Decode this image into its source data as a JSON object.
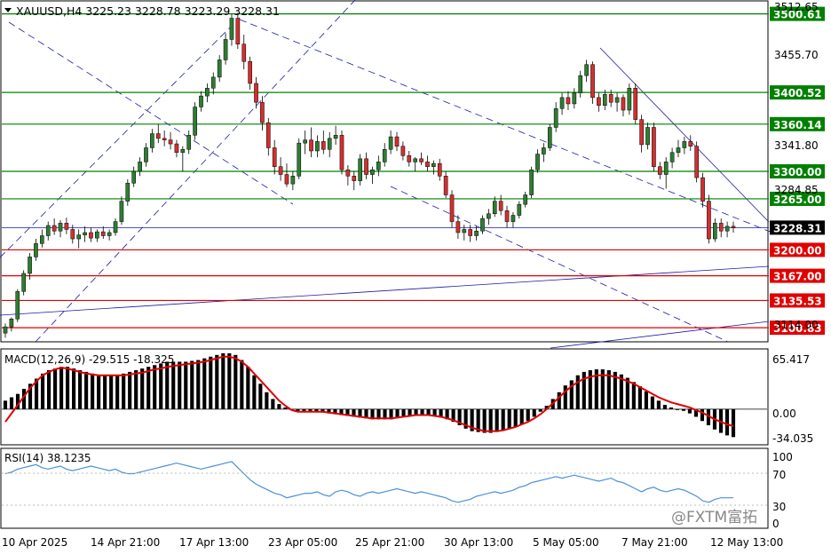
{
  "header": {
    "symbol_line": "XAUUSD,H4  3225.23 3228.78 3223.29 3228.31",
    "dropdown_icon": "triangle-down-icon"
  },
  "colors": {
    "bull": "#2e7d32",
    "bear": "#d32f2f",
    "support": "#e00000",
    "resistance": "#008000",
    "trend": "#1a1aa8",
    "macd_hist": "#000000",
    "macd_signal": "#e00000",
    "rsi_line": "#4a90d9",
    "grid_text": "#000000"
  },
  "price_axis": {
    "top_label_partial": "3512.65",
    "tick_labels": [
      "3455.70",
      "3341.80",
      "3284.85",
      "3114.00"
    ]
  },
  "levels": [
    {
      "name": "resistance-3500",
      "value": 3500.61,
      "label": "3500.61",
      "kind": "resistance"
    },
    {
      "name": "resistance-3400",
      "value": 3400.52,
      "label": "3400.52",
      "kind": "resistance"
    },
    {
      "name": "resistance-3360",
      "value": 3360.14,
      "label": "3360.14",
      "kind": "resistance"
    },
    {
      "name": "resistance-3300",
      "value": 3300.0,
      "label": "3300.00",
      "kind": "resistance"
    },
    {
      "name": "resistance-3265",
      "value": 3265.0,
      "label": "3265.00",
      "kind": "resistance"
    },
    {
      "name": "current-price",
      "value": 3228.31,
      "label": "3228.31",
      "kind": "current"
    },
    {
      "name": "support-3200",
      "value": 3200.0,
      "label": "3200.00",
      "kind": "support"
    },
    {
      "name": "support-3167",
      "value": 3167.0,
      "label": "3167.00",
      "kind": "support"
    },
    {
      "name": "support-3135",
      "value": 3135.53,
      "label": "3135.53",
      "kind": "support"
    },
    {
      "name": "support-3100",
      "value": 3100.83,
      "label": "3100.83",
      "kind": "support"
    }
  ],
  "macd": {
    "title": "MACD(12,26,9) -29.515 -18.325",
    "tick_labels": [
      "65.417",
      "0.00",
      "-34.035"
    ],
    "ylim": [
      -40,
      68
    ]
  },
  "rsi": {
    "title": "RSI(14) 38.1235",
    "tick_labels": [
      "100",
      "70",
      "30",
      "0"
    ],
    "ylim": [
      0,
      100
    ]
  },
  "time_axis": {
    "labels": [
      "10 Apr 2025",
      "14 Apr 21:00",
      "17 Apr 13:00",
      "23 Apr 05:00",
      "25 Apr 21:00",
      "30 Apr 13:00",
      "5 May 05:00",
      "7 May 21:00",
      "12 May 13:00"
    ]
  },
  "watermark": {
    "text": "@FXTM富拓"
  },
  "chart_data": {
    "type": "candlestick",
    "symbol": "XAUUSD",
    "timeframe": "H4",
    "ylim": [
      3084,
      3516
    ],
    "candles": [
      [
        3094,
        3106,
        3088,
        3102
      ],
      [
        3102,
        3114,
        3096,
        3112
      ],
      [
        3112,
        3150,
        3108,
        3147
      ],
      [
        3147,
        3174,
        3142,
        3170
      ],
      [
        3170,
        3196,
        3162,
        3191
      ],
      [
        3191,
        3214,
        3186,
        3208
      ],
      [
        3208,
        3226,
        3203,
        3218
      ],
      [
        3218,
        3236,
        3212,
        3231
      ],
      [
        3231,
        3240,
        3219,
        3224
      ],
      [
        3224,
        3238,
        3216,
        3234
      ],
      [
        3234,
        3241,
        3220,
        3226
      ],
      [
        3226,
        3232,
        3208,
        3214
      ],
      [
        3214,
        3226,
        3202,
        3219
      ],
      [
        3219,
        3230,
        3210,
        3222
      ],
      [
        3222,
        3228,
        3210,
        3215
      ],
      [
        3215,
        3226,
        3210,
        3223
      ],
      [
        3223,
        3230,
        3214,
        3218
      ],
      [
        3218,
        3226,
        3212,
        3222
      ],
      [
        3222,
        3240,
        3218,
        3236
      ],
      [
        3236,
        3268,
        3232,
        3262
      ],
      [
        3262,
        3290,
        3256,
        3285
      ],
      [
        3285,
        3306,
        3280,
        3300
      ],
      [
        3300,
        3318,
        3294,
        3312
      ],
      [
        3312,
        3336,
        3306,
        3330
      ],
      [
        3330,
        3354,
        3324,
        3348
      ],
      [
        3348,
        3360,
        3336,
        3342
      ],
      [
        3342,
        3352,
        3332,
        3340
      ],
      [
        3340,
        3350,
        3328,
        3335
      ],
      [
        3335,
        3340,
        3318,
        3324
      ],
      [
        3324,
        3332,
        3300,
        3328
      ],
      [
        3328,
        3352,
        3322,
        3346
      ],
      [
        3346,
        3388,
        3340,
        3382
      ],
      [
        3382,
        3402,
        3376,
        3396
      ],
      [
        3396,
        3412,
        3388,
        3406
      ],
      [
        3406,
        3426,
        3398,
        3420
      ],
      [
        3420,
        3448,
        3414,
        3442
      ],
      [
        3442,
        3476,
        3436,
        3468
      ],
      [
        3468,
        3500,
        3460,
        3495
      ],
      [
        3495,
        3502,
        3456,
        3462
      ],
      [
        3462,
        3474,
        3430,
        3440
      ],
      [
        3440,
        3446,
        3404,
        3412
      ],
      [
        3412,
        3420,
        3380,
        3388
      ],
      [
        3388,
        3396,
        3352,
        3362
      ],
      [
        3362,
        3368,
        3320,
        3330
      ],
      [
        3330,
        3340,
        3296,
        3306
      ],
      [
        3306,
        3318,
        3288,
        3296
      ],
      [
        3296,
        3310,
        3280,
        3284
      ],
      [
        3284,
        3300,
        3276,
        3294
      ],
      [
        3294,
        3342,
        3290,
        3336
      ],
      [
        3336,
        3352,
        3322,
        3340
      ],
      [
        3340,
        3356,
        3318,
        3326
      ],
      [
        3326,
        3346,
        3318,
        3338
      ],
      [
        3338,
        3352,
        3322,
        3328
      ],
      [
        3328,
        3350,
        3318,
        3342
      ],
      [
        3342,
        3358,
        3334,
        3346
      ],
      [
        3346,
        3352,
        3296,
        3302
      ],
      [
        3302,
        3308,
        3282,
        3294
      ],
      [
        3294,
        3300,
        3276,
        3288
      ],
      [
        3288,
        3322,
        3282,
        3316
      ],
      [
        3316,
        3324,
        3290,
        3296
      ],
      [
        3296,
        3306,
        3284,
        3302
      ],
      [
        3302,
        3320,
        3294,
        3312
      ],
      [
        3312,
        3336,
        3306,
        3328
      ],
      [
        3328,
        3352,
        3322,
        3344
      ],
      [
        3344,
        3350,
        3326,
        3332
      ],
      [
        3332,
        3338,
        3314,
        3320
      ],
      [
        3320,
        3326,
        3306,
        3312
      ],
      [
        3312,
        3318,
        3300,
        3316
      ],
      [
        3316,
        3324,
        3308,
        3312
      ],
      [
        3312,
        3320,
        3300,
        3306
      ],
      [
        3306,
        3314,
        3296,
        3310
      ],
      [
        3310,
        3316,
        3288,
        3294
      ],
      [
        3294,
        3300,
        3266,
        3270
      ],
      [
        3270,
        3276,
        3228,
        3236
      ],
      [
        3236,
        3244,
        3214,
        3222
      ],
      [
        3222,
        3232,
        3212,
        3226
      ],
      [
        3226,
        3232,
        3210,
        3218
      ],
      [
        3218,
        3230,
        3212,
        3224
      ],
      [
        3224,
        3244,
        3220,
        3240
      ],
      [
        3240,
        3252,
        3232,
        3246
      ],
      [
        3246,
        3268,
        3242,
        3262
      ],
      [
        3262,
        3270,
        3244,
        3250
      ],
      [
        3250,
        3256,
        3228,
        3236
      ],
      [
        3236,
        3248,
        3228,
        3244
      ],
      [
        3244,
        3262,
        3240,
        3258
      ],
      [
        3258,
        3274,
        3254,
        3270
      ],
      [
        3270,
        3306,
        3266,
        3302
      ],
      [
        3302,
        3328,
        3298,
        3322
      ],
      [
        3322,
        3336,
        3312,
        3330
      ],
      [
        3330,
        3360,
        3326,
        3356
      ],
      [
        3356,
        3388,
        3350,
        3380
      ],
      [
        3380,
        3400,
        3372,
        3394
      ],
      [
        3394,
        3402,
        3378,
        3386
      ],
      [
        3386,
        3406,
        3380,
        3400
      ],
      [
        3400,
        3428,
        3394,
        3422
      ],
      [
        3422,
        3442,
        3414,
        3436
      ],
      [
        3436,
        3440,
        3386,
        3394
      ],
      [
        3394,
        3400,
        3376,
        3384
      ],
      [
        3384,
        3404,
        3378,
        3398
      ],
      [
        3398,
        3404,
        3382,
        3388
      ],
      [
        3388,
        3400,
        3376,
        3394
      ],
      [
        3394,
        3398,
        3370,
        3378
      ],
      [
        3378,
        3412,
        3372,
        3406
      ],
      [
        3406,
        3412,
        3360,
        3366
      ],
      [
        3366,
        3372,
        3324,
        3334
      ],
      [
        3334,
        3362,
        3328,
        3356
      ],
      [
        3356,
        3362,
        3300,
        3306
      ],
      [
        3306,
        3312,
        3290,
        3296
      ],
      [
        3296,
        3318,
        3278,
        3312
      ],
      [
        3312,
        3330,
        3304,
        3324
      ],
      [
        3324,
        3340,
        3318,
        3330
      ],
      [
        3330,
        3344,
        3322,
        3338
      ],
      [
        3338,
        3346,
        3326,
        3332
      ],
      [
        3332,
        3338,
        3286,
        3292
      ],
      [
        3292,
        3298,
        3254,
        3262
      ],
      [
        3262,
        3270,
        3208,
        3214
      ],
      [
        3214,
        3240,
        3210,
        3234
      ],
      [
        3234,
        3240,
        3216,
        3224
      ],
      [
        3224,
        3236,
        3216,
        3230
      ],
      [
        3230,
        3236,
        3222,
        3228
      ]
    ],
    "macd_values": [
      10,
      14,
      18,
      24,
      30,
      36,
      42,
      46,
      48,
      50,
      50,
      48,
      46,
      44,
      42,
      40,
      40,
      40,
      40,
      42,
      44,
      46,
      48,
      50,
      52,
      54,
      56,
      56,
      56,
      56,
      57,
      58,
      60,
      62,
      64,
      66,
      66,
      64,
      58,
      50,
      40,
      30,
      20,
      12,
      6,
      2,
      -1,
      -2,
      -2,
      -2,
      -3,
      -4,
      -5,
      -6,
      -7,
      -8,
      -9,
      -10,
      -11,
      -12,
      -12,
      -12,
      -12,
      -10,
      -9,
      -8,
      -7,
      -7,
      -7,
      -8,
      -10,
      -12,
      -15,
      -19,
      -23,
      -26,
      -27,
      -28,
      -28,
      -27,
      -25,
      -23,
      -21,
      -18,
      -14,
      -9,
      -3,
      4,
      12,
      20,
      28,
      34,
      40,
      44,
      46,
      47,
      47,
      46,
      44,
      41,
      37,
      32,
      27,
      21,
      15,
      10,
      5,
      2,
      0,
      -2,
      -5,
      -9,
      -14,
      -19,
      -24,
      -28,
      -31,
      -33
    ],
    "macd_signal": [
      -15,
      -5,
      5,
      15,
      25,
      33,
      40,
      44,
      47,
      49,
      48,
      46,
      44,
      42,
      41,
      40,
      40,
      40,
      40,
      40,
      41,
      42,
      43,
      45,
      47,
      48,
      50,
      51,
      52,
      53,
      54,
      55,
      56,
      58,
      60,
      62,
      62,
      60,
      56,
      50,
      42,
      34,
      26,
      18,
      10,
      4,
      -1,
      -3,
      -3,
      -3,
      -3,
      -3,
      -4,
      -5,
      -6,
      -7,
      -8,
      -9,
      -10,
      -11,
      -11,
      -11,
      -11,
      -10,
      -9,
      -8,
      -7,
      -7,
      -7,
      -8,
      -9,
      -11,
      -13,
      -16,
      -19,
      -22,
      -24,
      -26,
      -26,
      -26,
      -25,
      -23,
      -21,
      -18,
      -15,
      -11,
      -6,
      0,
      7,
      14,
      21,
      27,
      32,
      36,
      38,
      40,
      40,
      40,
      38,
      36,
      33,
      30,
      26,
      22,
      18,
      14,
      11,
      8,
      6,
      4,
      2,
      -1,
      -4,
      -8,
      -12,
      -15,
      -18,
      -20
    ],
    "rsi_values": [
      70,
      72,
      76,
      78,
      80,
      82,
      78,
      76,
      78,
      80,
      76,
      74,
      76,
      78,
      80,
      78,
      76,
      74,
      76,
      72,
      70,
      70,
      72,
      74,
      76,
      78,
      80,
      82,
      84,
      82,
      80,
      78,
      76,
      78,
      80,
      82,
      84,
      86,
      78,
      70,
      62,
      56,
      52,
      48,
      44,
      42,
      38,
      40,
      42,
      44,
      44,
      46,
      42,
      40,
      46,
      48,
      46,
      42,
      40,
      44,
      46,
      44,
      46,
      48,
      50,
      48,
      46,
      44,
      46,
      44,
      42,
      40,
      38,
      34,
      32,
      34,
      36,
      40,
      42,
      44,
      46,
      44,
      46,
      48,
      52,
      54,
      58,
      60,
      62,
      64,
      66,
      64,
      66,
      68,
      66,
      64,
      62,
      60,
      62,
      64,
      60,
      58,
      54,
      50,
      46,
      50,
      52,
      48,
      46,
      48,
      50,
      48,
      44,
      40,
      34,
      32,
      36,
      38,
      38,
      38
    ]
  }
}
